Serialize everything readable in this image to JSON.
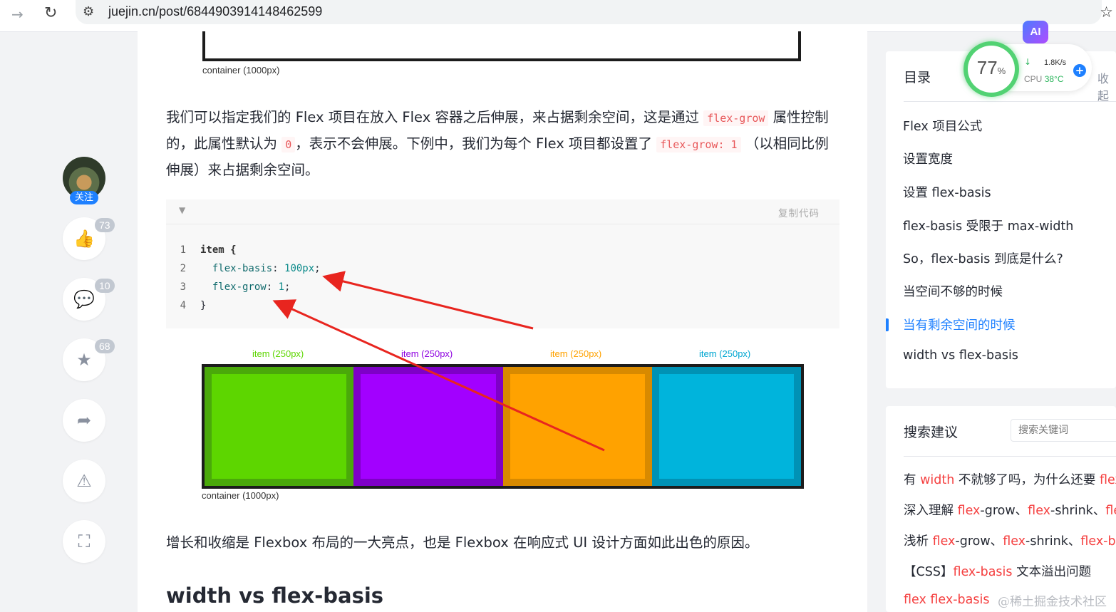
{
  "browser": {
    "url": "juejin.cn/post/6844903914148462599"
  },
  "rail": {
    "follow": "关注",
    "like_count": "73",
    "comment_count": "10",
    "collect_count": "68"
  },
  "article": {
    "top_caption": "container (1000px)",
    "para1_a": "我们可以指定我们的 Flex 项目在放入 Flex 容器之后伸展，来占据剩余空间，这是通过",
    "para1_code1": "flex-grow",
    "para1_b": "属性控制的，此属性默认为",
    "para1_code2": "0",
    "para1_c": "，表示不会伸展。下例中，我们为每个 Flex 项目都设置了",
    "para1_code3": "flex-grow: 1",
    "para1_d": "（以相同比例伸展）来占据剩余空间。",
    "copy_label": "复制代码",
    "code": {
      "lines": [
        {
          "n": "1",
          "text": "item {"
        },
        {
          "n": "2",
          "prop": "flex-basis",
          "val": "100px"
        },
        {
          "n": "3",
          "prop": "flex-grow",
          "val": "1"
        },
        {
          "n": "4",
          "text": "}"
        }
      ]
    },
    "diagram": {
      "items": [
        {
          "label": "item (250px)",
          "color": "#5dd600",
          "border": "#4aa90a",
          "label_color": "#5dd600"
        },
        {
          "label": "item (250px)",
          "color": "#a200ff",
          "border": "#7e00c7",
          "label_color": "#8e00e0"
        },
        {
          "label": "item (250px)",
          "color": "#ffa200",
          "border": "#d88a00",
          "label_color": "#ffa200"
        },
        {
          "label": "item (250px)",
          "color": "#00b4dc",
          "border": "#0092b5",
          "label_color": "#00a6d1"
        }
      ],
      "caption": "container (1000px)"
    },
    "para2": "增长和收缩是 Flexbox 布局的一大亮点，也是 Flexbox 在响应式 UI 设计方面如此出色的原因。",
    "heading": "width vs flex-basis"
  },
  "toc": {
    "title": "目录",
    "collapse": "收起",
    "items": [
      "Flex 项目公式",
      "设置宽度",
      "设置 flex-basis",
      "flex-basis 受限于 max-width",
      "So，flex-basis 到底是什么?",
      "当空间不够的时候",
      "当有剩余空间的时候",
      "width vs flex-basis"
    ],
    "active_index": 6
  },
  "search": {
    "title": "搜索建议",
    "placeholder": "搜索关键词",
    "suggestions": [
      [
        {
          "t": "有 "
        },
        {
          "t": "width",
          "h": true
        },
        {
          "t": " 不就够了吗，为什么还要 "
        },
        {
          "t": "flex",
          "h": true
        }
      ],
      [
        {
          "t": "深入理解 "
        },
        {
          "t": "flex",
          "h": true
        },
        {
          "t": "-grow、"
        },
        {
          "t": "flex",
          "h": true
        },
        {
          "t": "-shrink、"
        },
        {
          "t": "fle",
          "h": true
        }
      ],
      [
        {
          "t": "浅析 "
        },
        {
          "t": "flex",
          "h": true
        },
        {
          "t": "-grow、"
        },
        {
          "t": "flex",
          "h": true
        },
        {
          "t": "-shrink、"
        },
        {
          "t": "flex-ba",
          "h": true
        }
      ],
      [
        {
          "t": "【CSS】"
        },
        {
          "t": "flex-basis",
          "h": true
        },
        {
          "t": " 文本溢出问题"
        }
      ],
      [
        {
          "t": "flex flex-basis",
          "h": true
        }
      ]
    ]
  },
  "widget": {
    "ai": "AI",
    "percent": "77",
    "percent_unit": "%",
    "net_speed": "1.8K/s",
    "cpu_label": "CPU",
    "cpu_temp": "38°C"
  },
  "watermark": "@稀土掘金技术社区"
}
